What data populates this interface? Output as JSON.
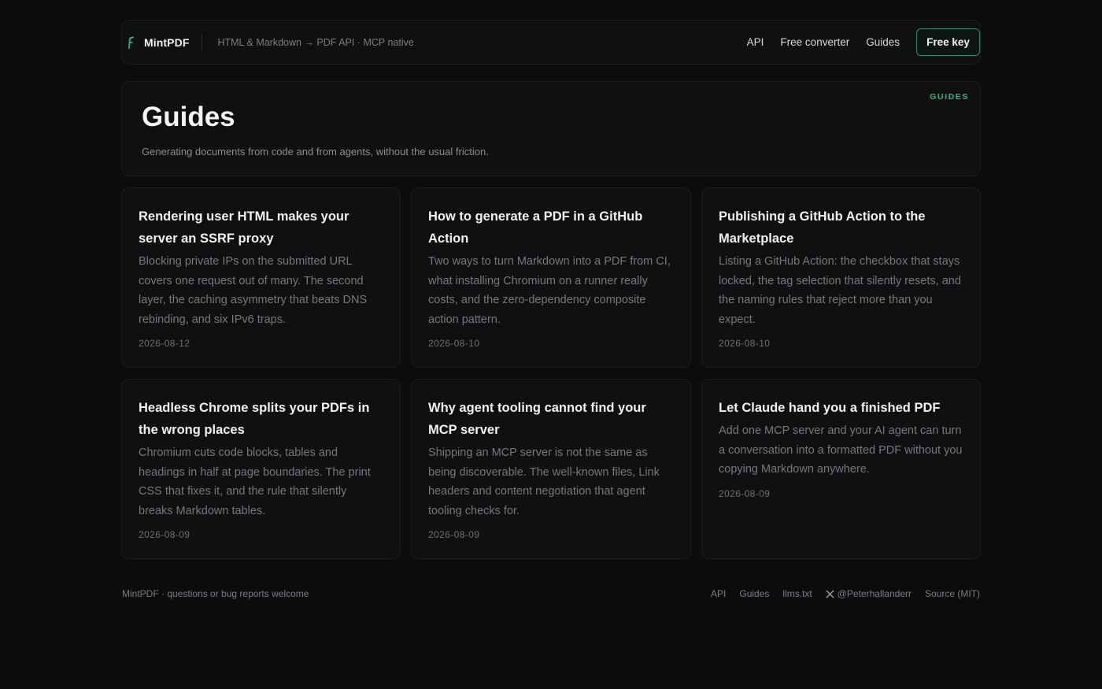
{
  "brand": {
    "name": "MintPDF",
    "tagline": "HTML & Markdown → PDF API · MCP native",
    "accent": "#2fb583"
  },
  "nav": {
    "links": [
      "API",
      "Free converter",
      "Guides"
    ],
    "cta": "Free key"
  },
  "hero": {
    "title": "Guides",
    "subtitle": "Generating documents from code and from agents, without the usual friction.",
    "badge": "GUIDES"
  },
  "cards": [
    {
      "title": "Rendering user HTML makes your server an SSRF proxy",
      "description": "Blocking private IPs on the submitted URL covers one request out of many. The second layer, the caching asymmetry that beats DNS rebinding, and six IPv6 traps.",
      "date": "2026-08-12"
    },
    {
      "title": "How to generate a PDF in a GitHub Action",
      "description": "Two ways to turn Markdown into a PDF from CI, what installing Chromium on a runner really costs, and the zero-dependency composite action pattern.",
      "date": "2026-08-10"
    },
    {
      "title": "Publishing a GitHub Action to the Marketplace",
      "description": "Listing a GitHub Action: the checkbox that stays locked, the tag selection that silently resets, and the naming rules that reject more than you expect.",
      "date": "2026-08-10"
    },
    {
      "title": "Headless Chrome splits your PDFs in the wrong places",
      "description": "Chromium cuts code blocks, tables and headings in half at page boundaries. The print CSS that fixes it, and the rule that silently breaks Markdown tables.",
      "date": "2026-08-09"
    },
    {
      "title": "Why agent tooling cannot find your MCP server",
      "description": "Shipping an MCP server is not the same as being discoverable. The well-known files, Link headers and content negotiation that agent tooling checks for.",
      "date": "2026-08-09"
    },
    {
      "title": "Let Claude hand you a finished PDF",
      "description": "Add one MCP server and your AI agent can turn a conversation into a formatted PDF without you copying Markdown anywhere.",
      "date": "2026-08-09"
    }
  ],
  "footer": {
    "left": "MintPDF · questions or bug reports welcome",
    "links": [
      "API",
      "Guides",
      "llms.txt",
      "@Peterhallanderr",
      "Source (MIT)"
    ],
    "x_icon": "x-logo-icon"
  }
}
